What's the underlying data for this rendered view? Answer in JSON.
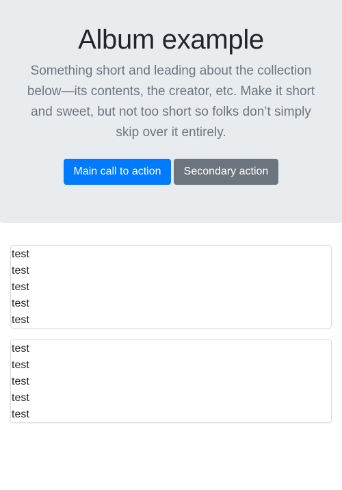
{
  "jumbotron": {
    "title": "Album example",
    "lead": "Something short and leading about the collection below—its contents, the creator, etc. Make it short and sweet, but not too short so folks don’t simply skip over it entirely.",
    "primary_button": "Main call to action",
    "secondary_button": "Secondary action"
  },
  "cards": [
    {
      "lines": [
        "test",
        "test",
        "test",
        "test",
        "test"
      ]
    },
    {
      "lines": [
        "test",
        "test",
        "test",
        "test",
        "test"
      ]
    }
  ],
  "colors": {
    "jumbotron_bg": "#e9ecef",
    "primary": "#007bff",
    "secondary": "#6c757d",
    "lead_text": "#6c757d"
  }
}
